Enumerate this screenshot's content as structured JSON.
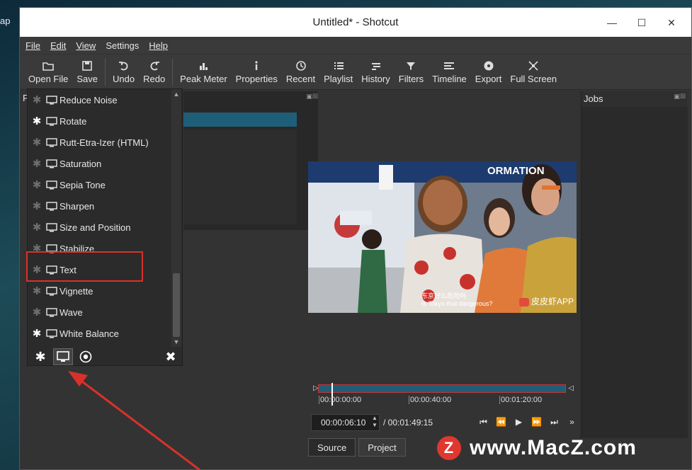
{
  "desktop": {
    "label": "ap"
  },
  "window": {
    "title": "Untitled* - Shotcut"
  },
  "menubar": [
    "File",
    "Edit",
    "View",
    "Settings",
    "Help"
  ],
  "toolbar": [
    {
      "label": "Open File",
      "icon": "open-file-icon"
    },
    {
      "label": "Save",
      "icon": "save-icon"
    },
    {
      "label": "Undo",
      "icon": "undo-icon"
    },
    {
      "label": "Redo",
      "icon": "redo-icon"
    },
    {
      "label": "Peak Meter",
      "icon": "peak-meter-icon"
    },
    {
      "label": "Properties",
      "icon": "properties-icon"
    },
    {
      "label": "Recent",
      "icon": "recent-icon"
    },
    {
      "label": "Playlist",
      "icon": "playlist-icon"
    },
    {
      "label": "History",
      "icon": "history-icon"
    },
    {
      "label": "Filters",
      "icon": "filters-icon"
    },
    {
      "label": "Timeline",
      "icon": "timeline-icon"
    },
    {
      "label": "Export",
      "icon": "export-icon"
    },
    {
      "label": "Full Screen",
      "icon": "full-screen-icon"
    }
  ],
  "filters": {
    "items": [
      {
        "label": "Reduce Noise",
        "favorite": false
      },
      {
        "label": "Rotate",
        "favorite": true
      },
      {
        "label": "Rutt-Etra-Izer (HTML)",
        "favorite": false
      },
      {
        "label": "Saturation",
        "favorite": false
      },
      {
        "label": "Sepia Tone",
        "favorite": false
      },
      {
        "label": "Sharpen",
        "favorite": false
      },
      {
        "label": "Size and Position",
        "favorite": false
      },
      {
        "label": "Stabilize",
        "favorite": false
      },
      {
        "label": "Text",
        "favorite": false
      },
      {
        "label": "Vignette",
        "favorite": false
      },
      {
        "label": "Wave",
        "favorite": false
      },
      {
        "label": "White Balance",
        "favorite": true
      }
    ],
    "highlighted": "Text",
    "dock_label": "F"
  },
  "viewer": {
    "subtitle_line1": "东京好么危险吗",
    "subtitle_line2": "Is Tokyo that dangerous?",
    "app_tag": "皮皮虾APP",
    "banner": "ORMATION"
  },
  "jobs": {
    "title": "Jobs"
  },
  "timeline": {
    "ticks": [
      "00:00:00:00",
      "00:00:40:00",
      "00:01:20:00"
    ],
    "position": "00:00:06:10",
    "duration": "/ 00:01:49:15"
  },
  "transport": [
    "⏮",
    "⏪",
    "▶",
    "⏩",
    "⏭",
    "»"
  ],
  "tabs": [
    "Source",
    "Project"
  ],
  "watermark": {
    "text": "www.MacZ.com",
    "logo": "Z"
  },
  "colors": {
    "highlight": "#d9312a",
    "accent": "#1f5e78"
  }
}
